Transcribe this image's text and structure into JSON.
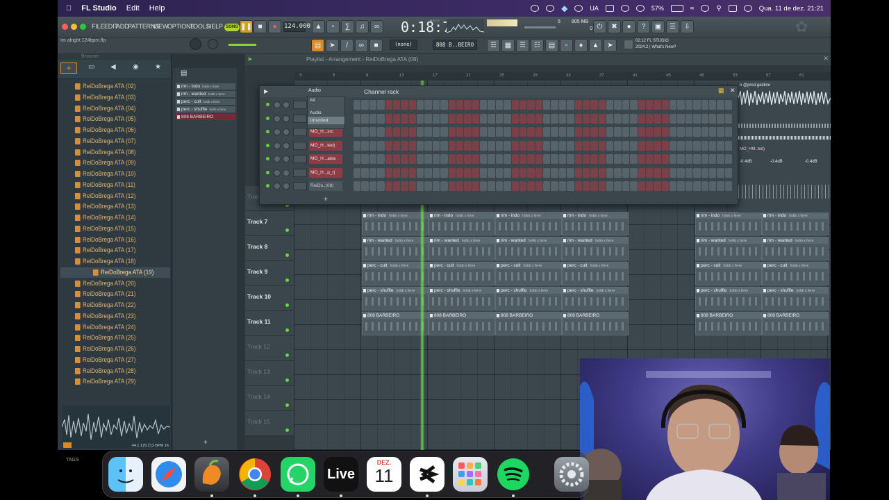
{
  "menubar": {
    "app_name": "FL Studio",
    "items": [
      "Edit",
      "Help"
    ],
    "keyboard": "UA",
    "battery": "57%",
    "datetime": "Qua. 11 de dez.  21:21"
  },
  "fl": {
    "menu": [
      "FILE",
      "EDIT",
      "ADD",
      "PATTERNS",
      "VIEW",
      "OPTIONS",
      "TOOLS",
      "HELP"
    ],
    "song_mode": "SONG",
    "tempo": "124.000",
    "time": "0:18:72",
    "time_label": "M:S:CS",
    "cpu_count": "5",
    "memory": "805 MB",
    "memory_sub": "0",
    "hint": "Im alright 124bpm.flp",
    "pattern_select": "(none)",
    "channel_select": "808 B..BEIRO",
    "news_title": "02:12  FL STUDIO",
    "news_sub": "2024.2 | What's New?"
  },
  "browser": {
    "title": "Browser",
    "items": [
      "ReiDoBrega ATA (02)",
      "ReiDoBrega ATA (03)",
      "ReiDoBrega ATA (04)",
      "ReiDoBrega ATA (05)",
      "ReiDoBrega ATA (06)",
      "ReiDoBrega ATA (07)",
      "ReiDoBrega ATA (08)",
      "ReiDoBrega ATA (09)",
      "ReiDoBrega ATA (10)",
      "ReiDoBrega ATA (11)",
      "ReiDoBrega ATA (12)",
      "ReiDoBrega ATA (13)",
      "ReiDoBrega ATA (14)",
      "ReiDoBrega ATA (15)",
      "ReiDoBrega ATA (16)",
      "ReiDoBrega ATA (17)",
      "ReiDoBrega ATA (18)",
      "ReiDoBrega ATA (19)",
      "ReiDoBrega ATA (20)",
      "ReiDoBrega ATA (21)",
      "ReiDoBrega ATA (22)",
      "ReiDoBrega ATA (23)",
      "ReiDoBrega ATA (24)",
      "ReiDoBrega ATA (25)",
      "ReiDoBrega ATA (26)",
      "ReiDoBrega ATA (27)",
      "ReiDoBrega ATA (28)",
      "ReiDoBrega ATA (29)"
    ],
    "selected_index": 17,
    "preview_info": "44.1  129.212  BPM 16",
    "tags_label": "TAGS"
  },
  "patterns": [
    {
      "name": "rim - indo",
      "tag": "hobb x ferre"
    },
    {
      "name": "rim - wanted",
      "tag": "hobb x ferre"
    },
    {
      "name": "perc - cult",
      "tag": "hobb x ferre"
    },
    {
      "name": "perc - shuffle",
      "tag": "hobb x ferre"
    },
    {
      "name": "808 BARBEIRO",
      "tag": ""
    }
  ],
  "playlist": {
    "breadcrumb": "Playlist - Arrangement  ›  ReiDoBrega ATA (08)",
    "ruler": [
      "3",
      "5",
      "9",
      "13",
      "17",
      "21",
      "25",
      "29",
      "33",
      "37",
      "41",
      "45",
      "49",
      "53",
      "57",
      "61"
    ],
    "tracks": [
      {
        "label": "Track 6",
        "active": false
      },
      {
        "label": "Track 7",
        "active": true
      },
      {
        "label": "Track 8",
        "active": true
      },
      {
        "label": "Track 9",
        "active": true
      },
      {
        "label": "Track 10",
        "active": true
      },
      {
        "label": "Track 11",
        "active": true
      },
      {
        "label": "Track 12",
        "active": false
      },
      {
        "label": "Track 13",
        "active": false
      },
      {
        "label": "Track 14",
        "active": false
      },
      {
        "label": "Track 15",
        "active": false
      }
    ],
    "clip_tag": "hobb x ferre",
    "right_panel_tag": "n @prod.galdino",
    "right_panel_db": "-0.4dB",
    "right_panel_clip": "MO_HM..ted)"
  },
  "rack": {
    "title": "Channel rack",
    "filter": "Audio",
    "dropdown": [
      "All",
      "Audio",
      "Unsorted"
    ],
    "swing_value": "5",
    "channels": [
      "",
      "",
      "MO_H...xrc",
      "MO_H...ted)",
      "MO_H...aixa",
      "MO_H...p_rj",
      "ReiDo..(08)"
    ]
  },
  "dock": {
    "apps": [
      "Finder",
      "Safari",
      "FL Studio",
      "Chrome",
      "WhatsApp",
      "Live",
      "Calendar",
      "Capcut",
      "Launchpad",
      "Spotify",
      "System Settings"
    ],
    "calendar_month": "DEZ.",
    "calendar_day": "11",
    "live_label": "Live"
  }
}
